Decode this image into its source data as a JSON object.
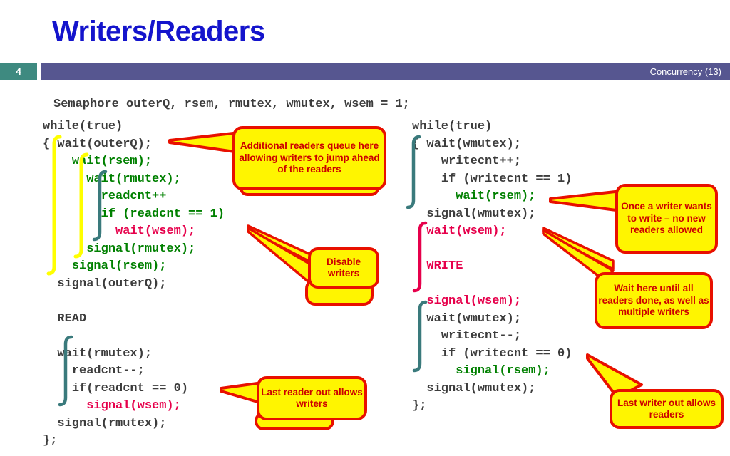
{
  "slide": {
    "title": "Writers/Readers",
    "page_number": "4",
    "footer_right": "Concurrency (13)",
    "accent_colors": {
      "title_blue": "#1414CC",
      "page_box_teal": "#3E8A80",
      "bar_purple": "#565690",
      "code_green": "#008000",
      "code_crimson": "#E6004B",
      "code_gray": "#3C3C3C",
      "balloon_yellow": "#FFF500",
      "balloon_red_border": "#E81000",
      "balloon_text_red": "#CC0000",
      "bracket_yellow": "#FFFF00",
      "bracket_teal": "#3A7A7C",
      "bracket_crimson": "#E6004B"
    }
  },
  "code": {
    "declaration": "Semaphore outerQ, rsem, rmutex, wmutex, wsem = 1;",
    "reader": {
      "lines": [
        {
          "indent": 0,
          "segments": [
            {
              "t": "while(true)",
              "c": "dk"
            }
          ]
        },
        {
          "indent": 0,
          "segments": [
            {
              "t": "{ ",
              "c": "dk"
            },
            {
              "t": "wait(outerQ);",
              "c": "dk"
            }
          ]
        },
        {
          "indent": 2,
          "segments": [
            {
              "t": "wait(rsem);",
              "c": "g"
            }
          ]
        },
        {
          "indent": 3,
          "segments": [
            {
              "t": "wait(rmutex);",
              "c": "g"
            }
          ]
        },
        {
          "indent": 4,
          "segments": [
            {
              "t": "readcnt++",
              "c": "g"
            }
          ]
        },
        {
          "indent": 4,
          "segments": [
            {
              "t": "if (readcnt == 1)",
              "c": "g"
            }
          ]
        },
        {
          "indent": 5,
          "segments": [
            {
              "t": "wait(wsem);",
              "c": "cr"
            }
          ]
        },
        {
          "indent": 3,
          "segments": [
            {
              "t": "signal(rmutex);",
              "c": "g"
            }
          ]
        },
        {
          "indent": 2,
          "segments": [
            {
              "t": "signal(rsem);",
              "c": "g"
            }
          ]
        },
        {
          "indent": 1,
          "segments": [
            {
              "t": "signal(outerQ);",
              "c": "dk"
            }
          ]
        },
        {
          "indent": 0,
          "segments": [
            {
              "t": "",
              "c": "dk"
            }
          ]
        },
        {
          "indent": 1,
          "segments": [
            {
              "t": "READ",
              "c": "dk"
            }
          ]
        },
        {
          "indent": 0,
          "segments": [
            {
              "t": "",
              "c": "dk"
            }
          ]
        },
        {
          "indent": 1,
          "segments": [
            {
              "t": "wait(rmutex);",
              "c": "dk"
            }
          ]
        },
        {
          "indent": 2,
          "segments": [
            {
              "t": "readcnt--;",
              "c": "dk"
            }
          ]
        },
        {
          "indent": 2,
          "segments": [
            {
              "t": "if(readcnt == 0)",
              "c": "dk"
            }
          ]
        },
        {
          "indent": 3,
          "segments": [
            {
              "t": "signal(wsem);",
              "c": "cr"
            }
          ]
        },
        {
          "indent": 1,
          "segments": [
            {
              "t": "signal(rmutex);",
              "c": "dk"
            }
          ]
        },
        {
          "indent": 0,
          "segments": [
            {
              "t": "};",
              "c": "dk"
            }
          ]
        }
      ]
    },
    "writer": {
      "lines": [
        {
          "indent": 0,
          "segments": [
            {
              "t": "while(true)",
              "c": "dk"
            }
          ]
        },
        {
          "indent": 0,
          "segments": [
            {
              "t": "{ wait(wmutex);",
              "c": "dk"
            }
          ]
        },
        {
          "indent": 2,
          "segments": [
            {
              "t": "writecnt++;",
              "c": "dk"
            }
          ]
        },
        {
          "indent": 2,
          "segments": [
            {
              "t": "if (writecnt == 1)",
              "c": "dk"
            }
          ]
        },
        {
          "indent": 3,
          "segments": [
            {
              "t": "wait(rsem);",
              "c": "g"
            }
          ]
        },
        {
          "indent": 1,
          "segments": [
            {
              "t": "signal(wmutex);",
              "c": "dk"
            }
          ]
        },
        {
          "indent": 1,
          "segments": [
            {
              "t": "wait(wsem);",
              "c": "cr"
            }
          ]
        },
        {
          "indent": 0,
          "segments": [
            {
              "t": "",
              "c": "dk"
            }
          ]
        },
        {
          "indent": 1,
          "segments": [
            {
              "t": "WRITE",
              "c": "cr"
            }
          ]
        },
        {
          "indent": 0,
          "segments": [
            {
              "t": "",
              "c": "dk"
            }
          ]
        },
        {
          "indent": 1,
          "segments": [
            {
              "t": "signal(wsem);",
              "c": "cr"
            }
          ]
        },
        {
          "indent": 1,
          "segments": [
            {
              "t": "wait(wmutex);",
              "c": "dk"
            }
          ]
        },
        {
          "indent": 2,
          "segments": [
            {
              "t": "writecnt--;",
              "c": "dk"
            }
          ]
        },
        {
          "indent": 2,
          "segments": [
            {
              "t": "if (writecnt == 0)",
              "c": "dk"
            }
          ]
        },
        {
          "indent": 3,
          "segments": [
            {
              "t": "signal(rsem);",
              "c": "g"
            }
          ]
        },
        {
          "indent": 1,
          "segments": [
            {
              "t": "signal(wmutex);",
              "c": "dk"
            }
          ]
        },
        {
          "indent": 0,
          "segments": [
            {
              "t": "};",
              "c": "dk"
            }
          ]
        }
      ]
    }
  },
  "callouts": {
    "readers_queue": "Additional readers queue here allowing writers to jump ahead of the readers",
    "disable_writers": "Disable writers",
    "last_reader_out": "Last reader out allows writers",
    "once_a_writer": "Once a writer wants to write – no new readers allowed",
    "wait_here_until": "Wait here until all readers done, as well as multiple writers",
    "last_writer_out": "Last writer out allows readers"
  }
}
